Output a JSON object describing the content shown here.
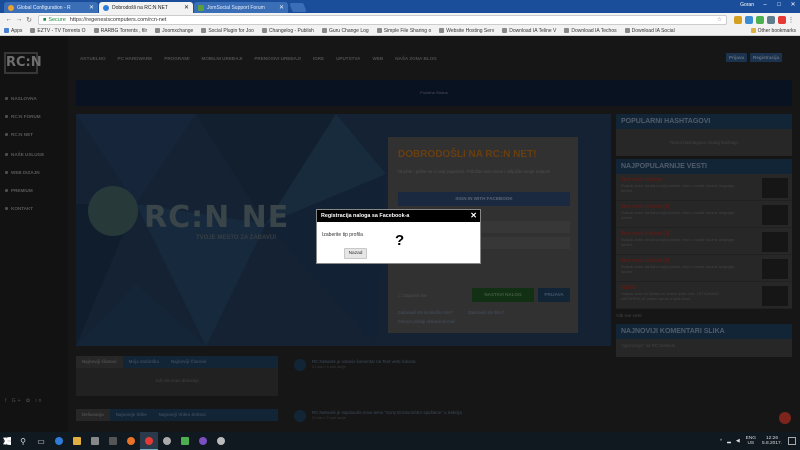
{
  "browser": {
    "tabs": [
      {
        "title": "Global Configuration - R",
        "icon": "joomla-icon",
        "active": false
      },
      {
        "title": "Dobrodošli na RC:N NET",
        "icon": "rcn-favicon-icon",
        "active": true
      },
      {
        "title": "JomSocial Support Forum",
        "icon": "jomsocial-icon",
        "active": false
      }
    ],
    "user": "Goran",
    "controls": {
      "minimize": "–",
      "maximize": "□",
      "close": "✕"
    },
    "secure_label": "Secure",
    "url": "https://regenesiscomputers.com/rcn-net",
    "bookmarks": [
      "Apps",
      "EZTV - TV Torrents O",
      "RARBG Torrents , filr",
      "Joomxchange",
      "Social Plugin for Joo",
      "Changelog - Publish",
      "Guru Change Log",
      "Simple File Sharing o",
      "Website Hosting Serv",
      "Download IA Teline V",
      "Download IA Techos",
      "Download IA Social"
    ],
    "other_bookmarks": "Other bookmarks"
  },
  "site": {
    "logo": "RC:N",
    "topnav": [
      "AKTUELNO",
      "PC HARDWARE",
      "PROGRAMI",
      "MOBILNI UREĐAJI",
      "PRENOSIVI UREĐAJI",
      "IGRE",
      "UPUTSTVA",
      "WEB",
      "NAŠA ZONA BLOG"
    ],
    "topnav_buttons": {
      "login": "Prijava",
      "register": "Registracija"
    },
    "sidenav": [
      "NASLOVNA",
      "RC:N FORUM",
      "RC:N NET",
      "NAŠE USLUGE",
      "WEB DIZAJN",
      "PREMIUM",
      "KONTAKT"
    ],
    "social": "f G+ ✿ in",
    "banner": "Početna Strana",
    "hero": {
      "logo_text": "RC:N NE",
      "slogan": "TVOJE MESTO ZA ZABAVU!"
    },
    "welcome": {
      "title": "DOBRODOŠLI NA RC:N NET!",
      "text": "Družite i pišite se o ovaj zajednici. Priložite sve nivoe i uključite svoje nalaze!",
      "fb_button": "SIGN IN WITH FACEBOOK",
      "remember": "Zapamti me",
      "login": "NASTAVI NALOG",
      "register": "PRIJAVA",
      "forgot_user": "Zaboravili ste korisničko ime?",
      "forgot_pass": "Zaboravili ste šifru?",
      "send_mail": "Ponovo pošalji aktivacioni mail"
    },
    "right_column": {
      "hashtags_title": "POPULARNI HASHTAGOVI",
      "hashtags_empty": "Nema hashtagova. Dodaj hashtag!",
      "news_title": "NAJPOPULARNIJE VESTI",
      "news": [
        {
          "title": "Test vesti rubona",
          "desc": "Svakak anim: da danu koji podržan, enim u ostale izlozne language da line."
        },
        {
          "title": "Test vesti rubona (2)",
          "desc": "Svakak anim: da danu koji podržan, enim u ostale izlozne language da line."
        },
        {
          "title": "Test vesti rubona (3)",
          "desc": "Svakak anim: da danu koji podržan, enim u ostale izlozne language da line."
        },
        {
          "title": "Test vesti rubona (4)",
          "desc": "Svakak anim: da danu koji podržan, enim u ostale izlozne language da line."
        },
        {
          "title": "MWFD",
          "desc": "Svakak anim do klinatu mi mdeve ipsin dolo. LETIQAMAR ANTHREHLAT potam ispum a toda dono."
        }
      ],
      "show_all": "Vidi sve vesti",
      "comments_title": "NAJNOVIJI KOMENTARI SLIKA",
      "comment": "\"agrusimgc\" od RC:Network"
    },
    "bottom_tabs": [
      "Najnoviji članovi",
      "Moja statistika",
      "Najnoviji Članovi"
    ],
    "bottom_empty": "Još nisi imao diskusija",
    "bottom_tabs2": [
      "Dešavanja",
      "Najnovije Slike",
      "Najnoviji Video Snimci"
    ],
    "activity": [
      {
        "text": "RC:Network je ostavio komentar na Test vesti rubona",
        "time": "21 dan i 5 sati ranije"
      },
      {
        "text": "RC:Network je napisao/la novu temu \"Sony Ericsson/ISA spuštene\" u Sekcija",
        "time": "21 dan i 5 sati ranije"
      }
    ]
  },
  "modal": {
    "title": "Registracija naloga sa Facebook-a",
    "close": "✕",
    "label": "Izaberite tip profila",
    "placeholder_mark": "?",
    "back_button": "Nazad"
  },
  "taskbar": {
    "lang": [
      "ENG",
      "US"
    ],
    "time": "12:26",
    "date": "5.8.2017."
  }
}
